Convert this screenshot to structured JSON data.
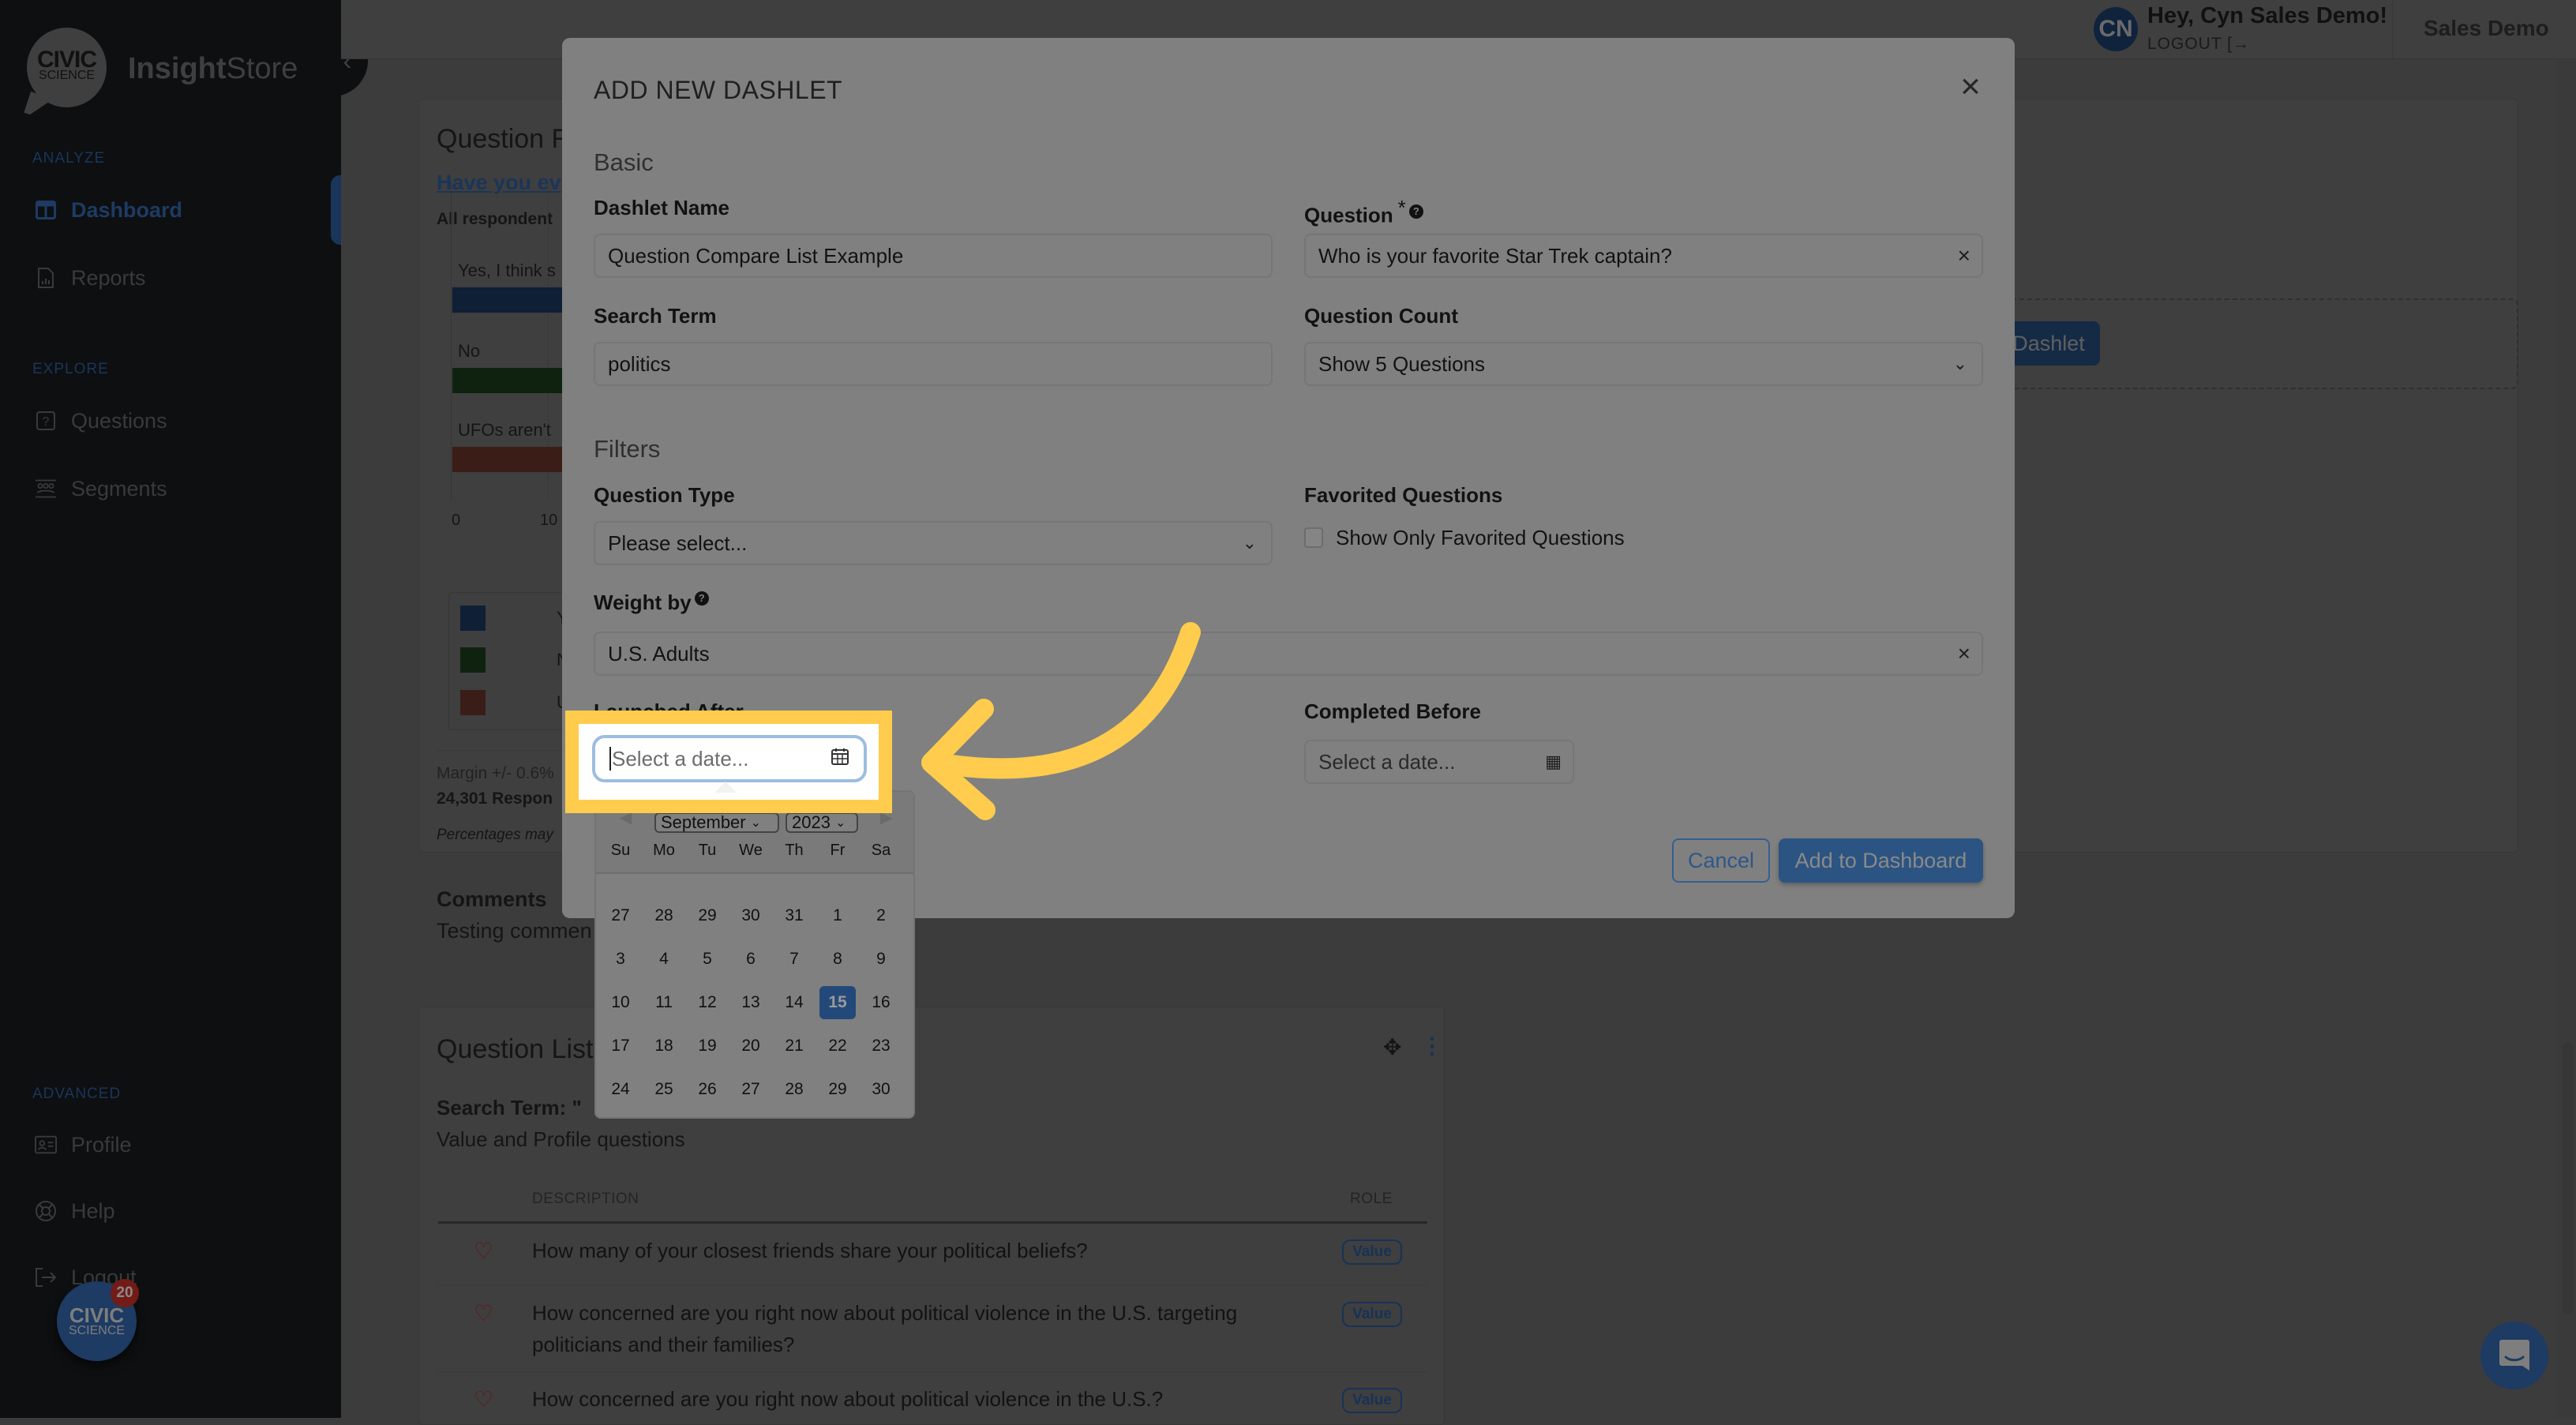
{
  "app": {
    "logo_line1": "CIVIC",
    "logo_line2": "SCIENCE",
    "brand_bold": "Insight",
    "brand_rest": "Store"
  },
  "sidebar": {
    "sections": [
      {
        "title": "ANALYZE",
        "items": [
          {
            "label": "Dashboard",
            "icon": "dashboard-icon",
            "active": true
          },
          {
            "label": "Reports",
            "icon": "report-icon"
          }
        ]
      },
      {
        "title": "EXPLORE",
        "items": [
          {
            "label": "Questions",
            "icon": "question-icon"
          },
          {
            "label": "Segments",
            "icon": "segments-icon"
          }
        ]
      },
      {
        "title": "ADVANCED",
        "items": [
          {
            "label": "Profile",
            "icon": "profile-card-icon"
          },
          {
            "label": "Help",
            "icon": "lifebuoy-icon"
          },
          {
            "label": "Logout",
            "icon": "logout-icon"
          }
        ]
      }
    ],
    "fab": {
      "line1": "CIVIC",
      "line2": "SCIENCE",
      "badge": "20"
    }
  },
  "topbar": {
    "avatar_initials": "CN",
    "greeting": "Hey, Cyn Sales Demo!",
    "logout": "LOGOUT",
    "org": "Sales Demo"
  },
  "background": {
    "result_card": {
      "title": "Question R",
      "question_link": "Have you ev",
      "subtitle": "All respondent",
      "bar_labels": [
        "Yes, I think s",
        "No",
        "UFOs aren't"
      ],
      "axis_ticks": [
        "0",
        "10"
      ],
      "legend_initials": [
        "Y",
        "N",
        "U"
      ],
      "margin": "Margin +/- 0.6%",
      "responses": "24,301 Respon",
      "note": "Percentages may",
      "comments_title": "Comments",
      "comments_text": "Testing commen"
    },
    "add_dashlet_button": "Dashlet",
    "question_list": {
      "title": "Question List",
      "search_term": "Search Term: \"",
      "subtitle": "Value and Profile questions",
      "columns": [
        "DESCRIPTION",
        "ROLE"
      ],
      "rows": [
        {
          "description": "How many of your closest friends share your political beliefs?",
          "role": "Value"
        },
        {
          "description": "How concerned are you right now about political violence in the U.S. targeting politicians and their families?",
          "role": "Value"
        },
        {
          "description": "How concerned are you right now about political violence in the U.S.?",
          "role": "Value"
        }
      ]
    }
  },
  "modal": {
    "title": "ADD NEW DASHLET",
    "sections": {
      "basic": "Basic",
      "filters": "Filters"
    },
    "fields": {
      "dashlet_name": {
        "label": "Dashlet Name",
        "value": "Question Compare List Example"
      },
      "question": {
        "label": "Question",
        "required": "*",
        "value": "Who is your favorite Star Trek captain?"
      },
      "search_term": {
        "label": "Search Term",
        "value": "politics"
      },
      "question_count": {
        "label": "Question Count",
        "value": "Show 5 Questions"
      },
      "question_type": {
        "label": "Question Type",
        "value": "Please select..."
      },
      "favorited": {
        "label": "Favorited Questions",
        "checkbox_label": "Show Only Favorited Questions",
        "checked": false
      },
      "weight_by": {
        "label": "Weight by",
        "value": "U.S. Adults"
      },
      "launched_after": {
        "label": "Launched After",
        "placeholder": "Select a date..."
      },
      "completed_before": {
        "label": "Completed Before",
        "placeholder": "Select a date..."
      }
    },
    "buttons": {
      "cancel": "Cancel",
      "add": "Add to Dashboard"
    }
  },
  "datepicker": {
    "month": "September",
    "year": "2023",
    "weekdays": [
      "Su",
      "Mo",
      "Tu",
      "We",
      "Th",
      "Fr",
      "Sa"
    ],
    "weeks": [
      [
        "27",
        "28",
        "29",
        "30",
        "31",
        "1",
        "2"
      ],
      [
        "3",
        "4",
        "5",
        "6",
        "7",
        "8",
        "9"
      ],
      [
        "10",
        "11",
        "12",
        "13",
        "14",
        "15",
        "16"
      ],
      [
        "17",
        "18",
        "19",
        "20",
        "21",
        "22",
        "23"
      ],
      [
        "24",
        "25",
        "26",
        "27",
        "28",
        "29",
        "30"
      ]
    ],
    "selected_day": "15"
  },
  "annotation": {
    "color": "#ffcc4d"
  },
  "colors": {
    "accent": "#2c5482",
    "bar_colors": [
      "#0f1f35",
      "#0f2210",
      "#3a1d17"
    ]
  }
}
